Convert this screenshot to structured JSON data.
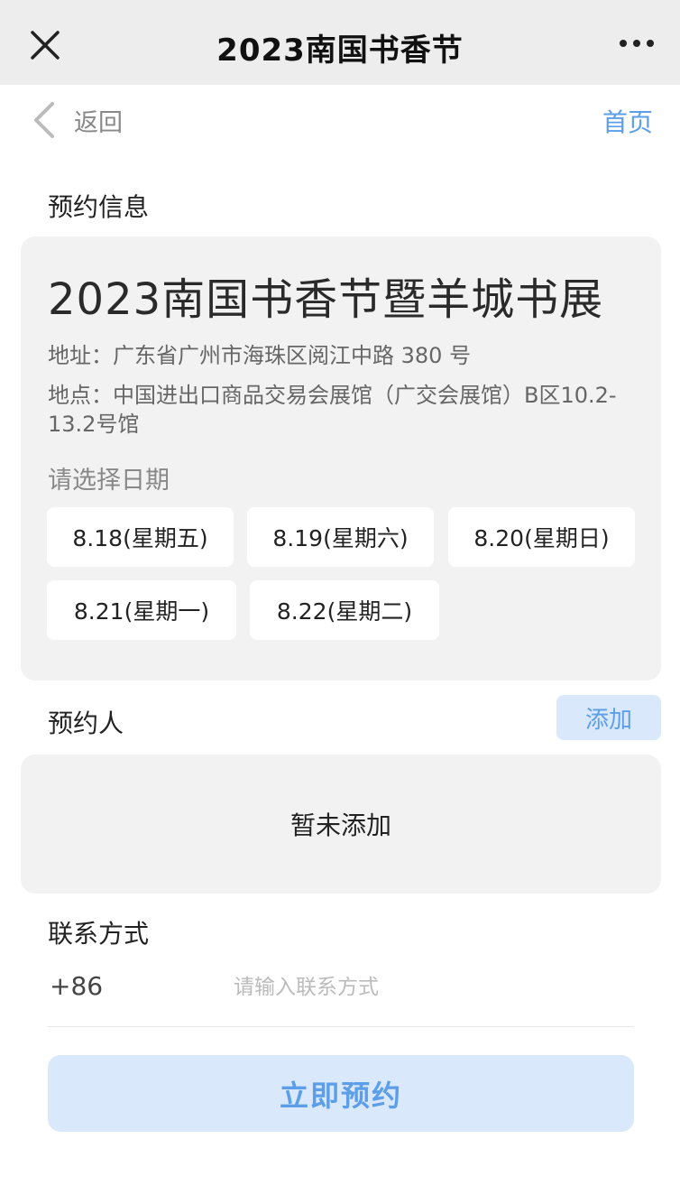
{
  "header": {
    "title": "2023南国书香节",
    "close_icon": "close-icon",
    "more_icon": "more-dots-icon"
  },
  "nav": {
    "back_label": "返回",
    "home_label": "首页"
  },
  "booking_info": {
    "section_label": "预约信息",
    "event_title": "2023南国书香节暨羊城书展",
    "address": "地址：广东省广州市海珠区阅江中路 380 号",
    "venue": "地点：中国进出口商品交易会展馆（广交会展馆）B区10.2-13.2号馆",
    "choose_date_label": "请选择日期",
    "dates": [
      "8.18(星期五)",
      "8.19(星期六)",
      "8.20(星期日)",
      "8.21(星期一)",
      "8.22(星期二)"
    ]
  },
  "booker": {
    "section_label": "预约人",
    "add_label": "添加",
    "empty_text": "暂未添加"
  },
  "contact": {
    "section_label": "联系方式",
    "country_code": "+86",
    "phone_placeholder": "请输入联系方式"
  },
  "submit_label": "立即预约",
  "colors": {
    "accent": "#5c9ee8",
    "accent_bg": "#d9e8fb",
    "card_bg": "#f2f2f2",
    "topbar_bg": "#ededed"
  }
}
